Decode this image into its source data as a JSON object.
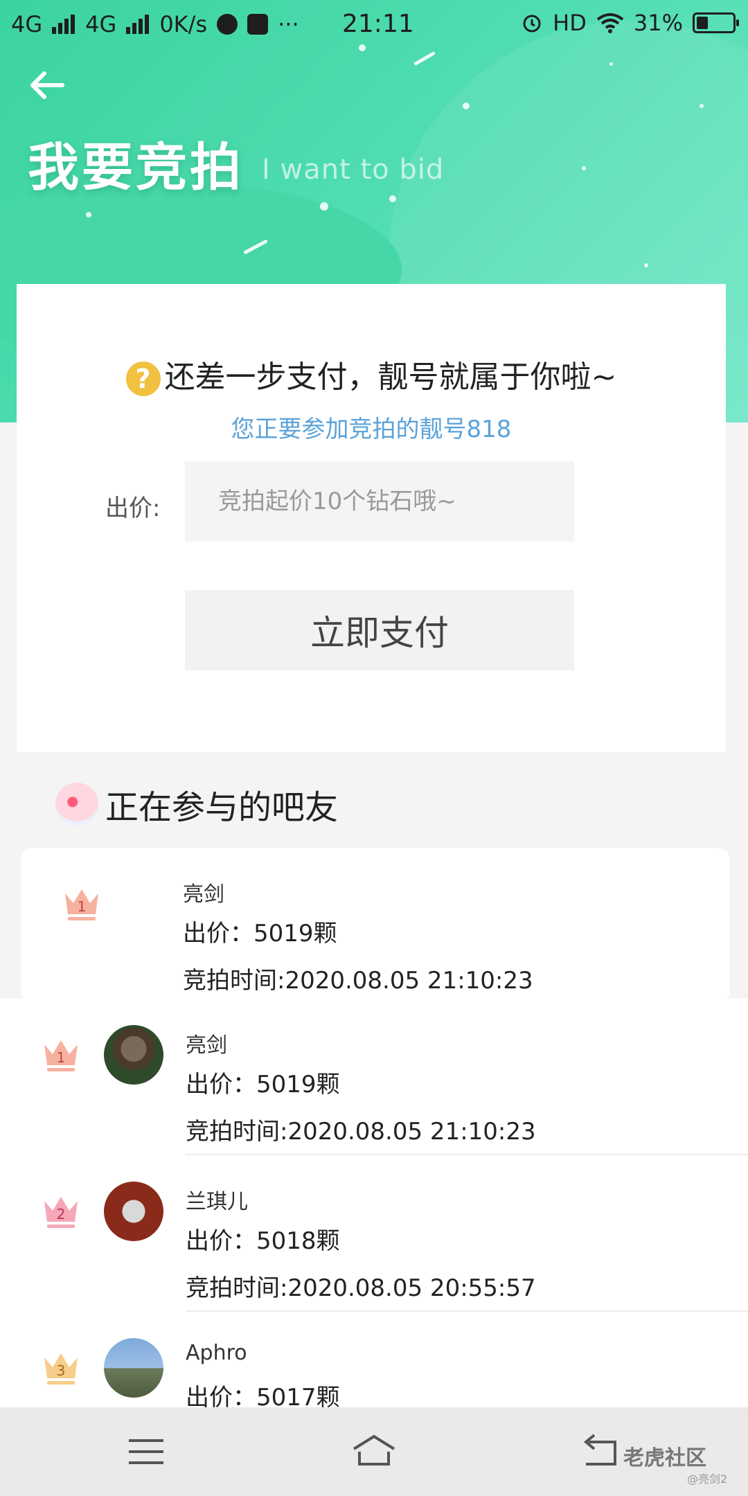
{
  "status_bar": {
    "network1": "4G",
    "network2": "4G",
    "speed": "0K/s",
    "more": "···",
    "time": "21:11",
    "hd": "HD",
    "battery": "31%",
    "battery_level": 0.31
  },
  "header": {
    "title": "我要竞拍",
    "subtitle": "I want to bid"
  },
  "card": {
    "prompt": "还差一步支付，靓号就属于你啦~",
    "subinfo": "您正要参加竞拍的靓号818",
    "bid_label": "出价:",
    "bid_placeholder": "竞拍起价10个钻石哦~",
    "pay_button": "立即支付"
  },
  "section": {
    "title": "正在参与的吧友"
  },
  "participants": [
    {
      "rank": "1",
      "name": "亮剑",
      "price": "出价：5019颗",
      "time": "竞拍时间:2020.08.05 21:10:23"
    },
    {
      "rank": "1",
      "name": "亮剑",
      "price": "出价：5019颗",
      "time": "竞拍时间:2020.08.05 21:10:23"
    },
    {
      "rank": "2",
      "name": "兰琪儿",
      "price": "出价：5018颗",
      "time": "竞拍时间:2020.08.05 20:55:57"
    },
    {
      "rank": "3",
      "name": "Aphro",
      "price": "出价：5017颗",
      "time": ""
    }
  ],
  "watermark": {
    "brand": "老虎社区",
    "user": "@亮剑2"
  }
}
